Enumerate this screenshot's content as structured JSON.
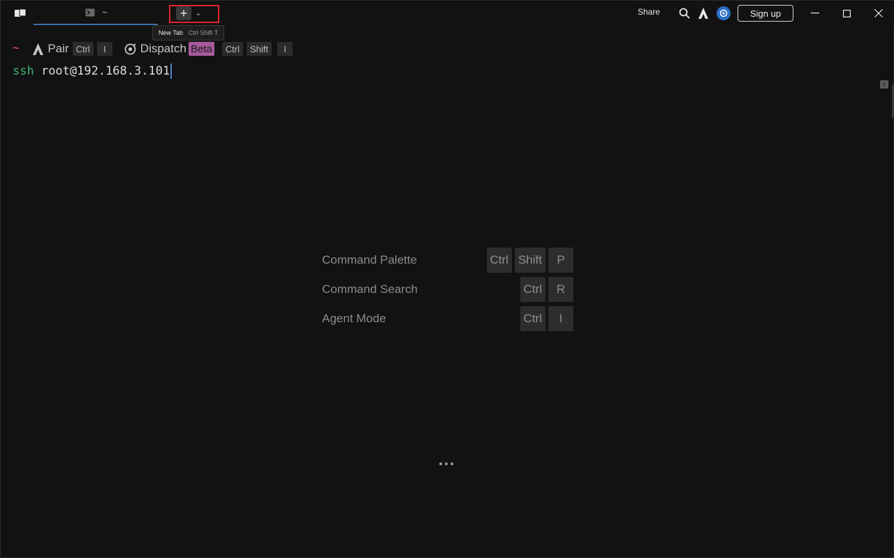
{
  "titlebar": {
    "tab_title": "~",
    "tooltip_label": "New Tab",
    "tooltip_shortcut": "Ctrl Shift T",
    "new_tab_symbol": "+",
    "new_tab_menu_symbol": "⌄",
    "share_label": "Share",
    "sign_up_label": "Sign up"
  },
  "prompt": {
    "directory": "~",
    "pair_label": "Pair",
    "pair_keys": [
      "Ctrl",
      "I"
    ],
    "dispatch_label": "Dispatch",
    "beta_badge": "Beta",
    "dispatch_keys": [
      "Ctrl",
      "Shift",
      "I"
    ]
  },
  "command": {
    "keyword": "ssh",
    "argument": " root@192.168.3.101"
  },
  "side_marker": "I",
  "shortcuts": [
    {
      "label": "Command Palette",
      "keys": [
        "Ctrl",
        "Shift",
        "P"
      ]
    },
    {
      "label": "Command Search",
      "keys": [
        "Ctrl",
        "R"
      ]
    },
    {
      "label": "Agent Mode",
      "keys": [
        "Ctrl",
        "I"
      ]
    }
  ],
  "colors": {
    "background": "#121212",
    "accent_blue": "#3c6fa8",
    "tilde_pink": "#d63aa4",
    "ssh_green": "#3cb371",
    "beta_badge": "#a85a9c",
    "highlight_red": "#e0262e"
  },
  "icons": [
    "app-icon",
    "terminal-icon",
    "plus-icon",
    "chevron-down-icon",
    "search-icon",
    "warp-icon",
    "gear-icon",
    "minimize-icon",
    "maximize-icon",
    "close-icon",
    "pair-icon",
    "dispatch-icon",
    "more-icon"
  ]
}
